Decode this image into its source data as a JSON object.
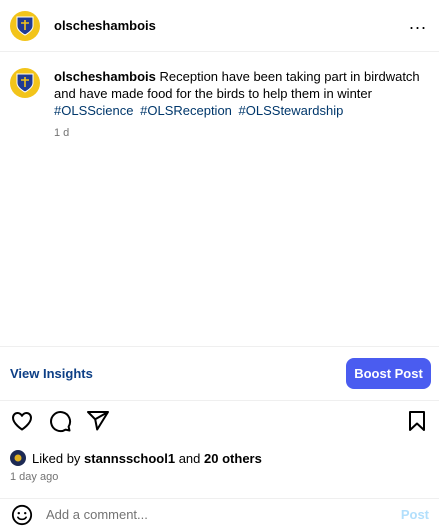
{
  "header": {
    "username": "olscheshambois",
    "more_label": "..."
  },
  "caption": {
    "username": "olscheshambois",
    "text": "Reception have been taking part in birdwatch and have made food for the birds to help them in winter",
    "hashtags": [
      "#OLSScience",
      "#OLSReception",
      "#OLSStewardship"
    ],
    "time_ago": "1 d"
  },
  "insights": {
    "view_label": "View Insights",
    "boost_label": "Boost Post"
  },
  "likes": {
    "prefix": "Liked by",
    "user": "stannsschool1",
    "connector": "and",
    "others": "20 others"
  },
  "date_text": "1 day ago",
  "comment": {
    "placeholder": "Add a comment...",
    "post_label": "Post"
  },
  "colors": {
    "accent": "#4a5cf0",
    "link": "#00376b",
    "insights": "#0d3f86",
    "crest": "#f2c41a",
    "muted": "#737373"
  }
}
